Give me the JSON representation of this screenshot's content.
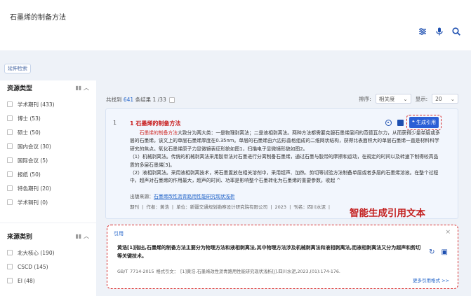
{
  "search": {
    "query": "石墨烯的制备方法"
  },
  "toolbar": {
    "advanced": "延伸检索"
  },
  "sidebar": {
    "resource_title": "资源类型",
    "resource_items": [
      "学术期刊 (433)",
      "博士 (53)",
      "硕士 (50)",
      "国内会议 (30)",
      "国际会议 (5)",
      "报纸 (50)",
      "特色期刊 (20)",
      "学术辑刊 (0)"
    ],
    "source_title": "来源类别",
    "source_items": [
      "北大核心 (190)",
      "CSCD (145)",
      "EI (48)"
    ]
  },
  "results_meta": {
    "prefix": "共找到",
    "count": "641",
    "suffix": "条结果",
    "page": "1 /33"
  },
  "sort": {
    "label": "排序:",
    "value": "相关度",
    "display_label": "显示:",
    "display_value": "20"
  },
  "result": {
    "index": "1",
    "title": "1 石墨烯的制备方法",
    "abstract_p1": "大致分为两大类：一是物理剥离法；二是液相剥离法。两种方法都需要克服石墨烯层间的范德瓦尔力，从而获得少量单层或多层的石墨烯。该文上的单层石墨烯厚度在0.35nm。单层的石墨烯由六边形晶格组成的二维网状结构，获得比表面积大的单层石墨烯一直是材料科学研究的焦点。氧化石墨烯原子力显微镜表征形貌如图1，扫描电子显微镜形貌如图2。",
    "abstract_p2": "（1）机械剥离法。传统的机械剥离法采用胶带法对石墨进行分离制备石墨烯，通过石墨与胶带的摩擦和运动，在规定的时间以及转速下制得较高品质的多层石墨烯[3]。",
    "abstract_p3": "（2）液相剥离法。采用液相剥离技术，将石墨置放在相关溶剂中，采用超声、加热、剪切等试验方法制备单层或者多层的石墨烯溶液。在整个过程中，超声对石墨烯的作用最大，超声的时间、功率是影响整个石墨转化为石墨烯的重要参数。收起 ^",
    "source_prefix": "出版来源：",
    "source_link": "石墨烯改性沥青路用性能研究现状浅析",
    "authors_line": "期刊 | 作者：黄浩 | 单位：新疆交通规划勘察设计研究院有限公司 | 2023 | 刊名：四川水泥 |",
    "generate_button": "生成引用"
  },
  "annotation": "智能生成引用文本",
  "citation": {
    "label": "引用",
    "close": "×",
    "text": "黄浩[1]指出,石墨烯的制备方法主要分为物理方法和液相剥离法,其中物理方法涉及机械剥离法和液相剥离法,而液相剥离法又分为超声和剪切等关键技术。",
    "footer": "GB/T 7714-2015   格式引文：  [1]黄浩.石墨烯改性沥青路用性能研究现状浅析[J].四川水泥,2023,(01):174-176.",
    "more": "更多引用格式 >>"
  }
}
